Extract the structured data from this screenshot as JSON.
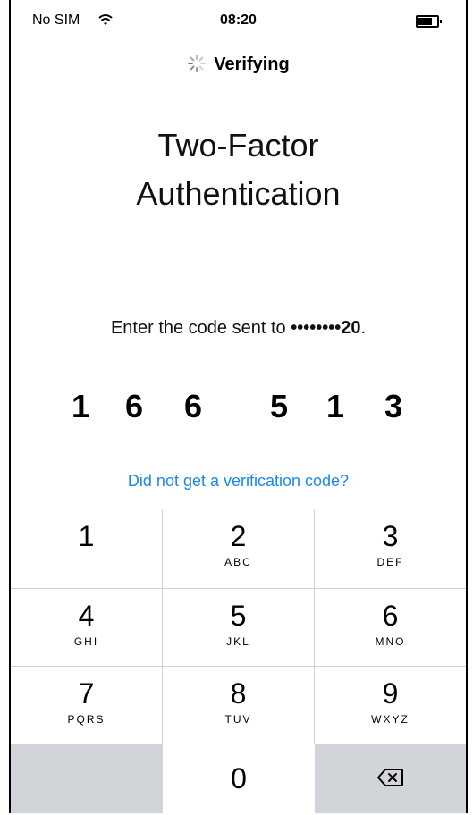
{
  "status_bar": {
    "carrier": "No SIM",
    "time": "08:20"
  },
  "verifying": {
    "label": "Verifying"
  },
  "title": {
    "line1": "Two-Factor",
    "line2": "Authentication"
  },
  "prompt": {
    "text": "Enter the code sent to ",
    "masked_number": "••••••••20",
    "suffix": "."
  },
  "code_digits": [
    "1",
    "6",
    "6",
    "5",
    "1",
    "3"
  ],
  "help_link": "Did not get a verification code?",
  "keypad": {
    "keys": [
      {
        "num": "1",
        "letters": ""
      },
      {
        "num": "2",
        "letters": "ABC"
      },
      {
        "num": "3",
        "letters": "DEF"
      },
      {
        "num": "4",
        "letters": "GHI"
      },
      {
        "num": "5",
        "letters": "JKL"
      },
      {
        "num": "6",
        "letters": "MNO"
      },
      {
        "num": "7",
        "letters": "PQRS"
      },
      {
        "num": "8",
        "letters": "TUV"
      },
      {
        "num": "9",
        "letters": "WXYZ"
      },
      {
        "num": "0",
        "letters": ""
      }
    ],
    "delete_icon": "backspace-icon",
    "blank_key_color": "#d1d4d9"
  },
  "colors": {
    "link": "#1e88e5",
    "divider": "#d0d0d0"
  }
}
